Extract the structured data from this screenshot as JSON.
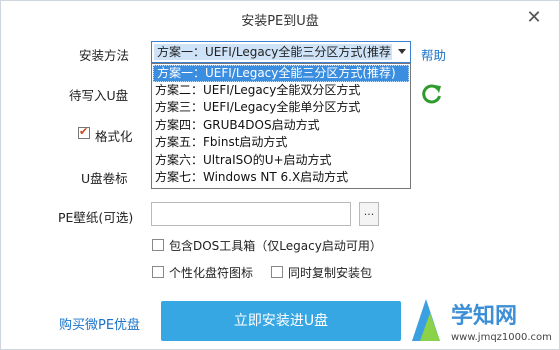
{
  "window": {
    "title": "安装PE到U盘",
    "close_glyph": "✕"
  },
  "form": {
    "install_method_label": "安装方法",
    "help_link": "帮助",
    "combo_selected": "方案一：UEFI/Legacy全能三分区方式(推荐)",
    "target_u_disk_label": "待写入U盘",
    "format_label": "格式化",
    "format_checked": true,
    "volume_label_label": "U盘卷标",
    "wallpaper_label": "PE壁纸(可选)",
    "wallpaper_value": "",
    "browse_button": "...",
    "opt_dos_label": "包含DOS工具箱（仅Legacy启动可用）",
    "opt_icon_label": "个性化盘符图标",
    "opt_copy_label": "同时复制安装包"
  },
  "dropdown": {
    "items": [
      "方案一：UEFI/Legacy全能三分区方式(推荐)",
      "方案二：UEFI/Legacy全能双分区方式",
      "方案三：UEFI/Legacy全能单分区方式",
      "方案四：GRUB4DOS启动方式",
      "方案五：Fbinst启动方式",
      "方案六：UltraISO的U+启动方式",
      "方案七：Windows NT 6.X启动方式"
    ],
    "active_index": 0
  },
  "footer": {
    "buy_link": "购买微PE优盘",
    "install_button": "立即安装进U盘"
  },
  "watermark": {
    "brand": "学知网",
    "url": "www.jmqz1000.com"
  },
  "colors": {
    "accent": "#37a7e3",
    "link": "#1a73c8",
    "refresh": "#2e9b2e"
  }
}
